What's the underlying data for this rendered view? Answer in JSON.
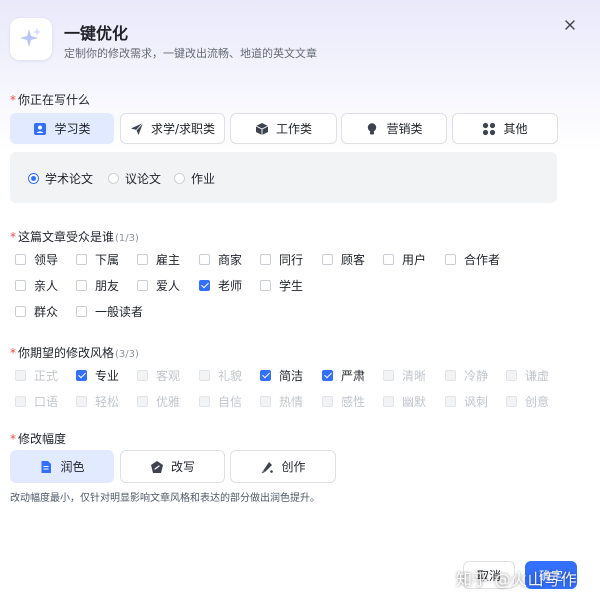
{
  "header": {
    "title": "一键优化",
    "subtitle": "定制你的修改需求，一键改出流畅、地道的英文文章"
  },
  "writing_type": {
    "label": "你正在写什么",
    "options": [
      {
        "label": "学习类",
        "icon": "person-card-icon",
        "active": true
      },
      {
        "label": "求学/求职类",
        "icon": "paper-plane-icon",
        "active": false
      },
      {
        "label": "工作类",
        "icon": "box-icon",
        "active": false
      },
      {
        "label": "营销类",
        "icon": "bulb-icon",
        "active": false
      },
      {
        "label": "其他",
        "icon": "grid-icon",
        "active": false
      }
    ],
    "sub_options": [
      {
        "label": "学术论文",
        "selected": true
      },
      {
        "label": "议论文",
        "selected": false
      },
      {
        "label": "作业",
        "selected": false
      }
    ]
  },
  "audience": {
    "label": "这篇文章受众是谁",
    "count": "(1/3)",
    "options": [
      {
        "label": "领导",
        "checked": false
      },
      {
        "label": "下属",
        "checked": false
      },
      {
        "label": "雇主",
        "checked": false
      },
      {
        "label": "商家",
        "checked": false
      },
      {
        "label": "同行",
        "checked": false
      },
      {
        "label": "顾客",
        "checked": false
      },
      {
        "label": "用户",
        "checked": false
      },
      {
        "label": "合作者",
        "checked": false
      },
      {
        "label": "亲人",
        "checked": false
      },
      {
        "label": "朋友",
        "checked": false
      },
      {
        "label": "爱人",
        "checked": false
      },
      {
        "label": "老师",
        "checked": true
      },
      {
        "label": "学生",
        "checked": false
      },
      {
        "label": "群众",
        "checked": false
      },
      {
        "label": "一般读者",
        "checked": false
      }
    ]
  },
  "style": {
    "label": "你期望的修改风格",
    "count": "(3/3)",
    "options": [
      {
        "label": "正式",
        "checked": false,
        "disabled": true
      },
      {
        "label": "专业",
        "checked": true,
        "disabled": false
      },
      {
        "label": "客观",
        "checked": false,
        "disabled": true
      },
      {
        "label": "礼貌",
        "checked": false,
        "disabled": true
      },
      {
        "label": "简洁",
        "checked": true,
        "disabled": false
      },
      {
        "label": "严肃",
        "checked": true,
        "disabled": false
      },
      {
        "label": "清晰",
        "checked": false,
        "disabled": true
      },
      {
        "label": "冷静",
        "checked": false,
        "disabled": true
      },
      {
        "label": "谦虚",
        "checked": false,
        "disabled": true
      },
      {
        "label": "口语",
        "checked": false,
        "disabled": true
      },
      {
        "label": "轻松",
        "checked": false,
        "disabled": true
      },
      {
        "label": "优雅",
        "checked": false,
        "disabled": true
      },
      {
        "label": "自信",
        "checked": false,
        "disabled": true
      },
      {
        "label": "热情",
        "checked": false,
        "disabled": true
      },
      {
        "label": "感性",
        "checked": false,
        "disabled": true
      },
      {
        "label": "幽默",
        "checked": false,
        "disabled": true
      },
      {
        "label": "讽刺",
        "checked": false,
        "disabled": true
      },
      {
        "label": "创意",
        "checked": false,
        "disabled": true
      }
    ]
  },
  "degree": {
    "label": "修改幅度",
    "options": [
      {
        "label": "润色",
        "icon": "document-icon",
        "active": true
      },
      {
        "label": "改写",
        "icon": "rewrite-icon",
        "active": false
      },
      {
        "label": "创作",
        "icon": "creative-icon",
        "active": false
      }
    ],
    "hint": "改动幅度最小，仅针对明显影响文章风格和表达的部分做出润色提升。"
  },
  "footer": {
    "cancel_label": "取消",
    "confirm_label": "确定"
  },
  "watermark": "知乎 @火山写作",
  "colors": {
    "accent": "#3370ff",
    "active_bg": "#e1eaff",
    "required": "#f54a45"
  }
}
